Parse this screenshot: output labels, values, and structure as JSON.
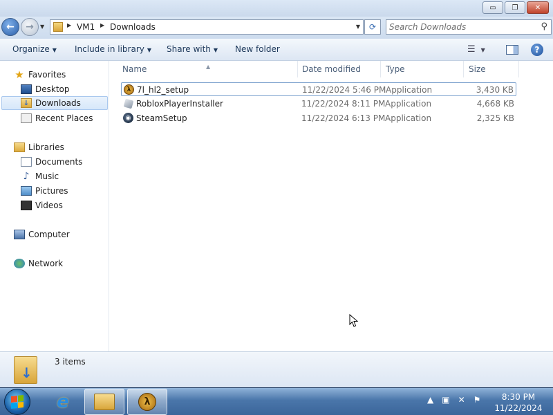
{
  "window": {
    "buttons": {
      "minimize": "▭",
      "maximize": "❐",
      "close": "✕"
    }
  },
  "address": {
    "segments": [
      "VM1",
      "Downloads"
    ],
    "search_placeholder": "Search Downloads"
  },
  "toolbar": {
    "organize": "Organize",
    "include_library": "Include in library",
    "share_with": "Share with",
    "new_folder": "New folder"
  },
  "nav": {
    "favorites": {
      "label": "Favorites",
      "items": [
        "Desktop",
        "Downloads",
        "Recent Places"
      ]
    },
    "libraries": {
      "label": "Libraries",
      "items": [
        "Documents",
        "Music",
        "Pictures",
        "Videos"
      ]
    },
    "computer": "Computer",
    "network": "Network"
  },
  "columns": {
    "name": "Name",
    "date": "Date modified",
    "type": "Type",
    "size": "Size"
  },
  "files": [
    {
      "name": "7l_hl2_setup",
      "date": "11/22/2024 5:46 PM",
      "type": "Application",
      "size": "3,430 KB",
      "icon": "hl-icon",
      "selected": true
    },
    {
      "name": "RobloxPlayerInstaller",
      "date": "11/22/2024 8:11 PM",
      "type": "Application",
      "size": "4,668 KB",
      "icon": "roblox-icon",
      "selected": false
    },
    {
      "name": "SteamSetup",
      "date": "11/22/2024 6:13 PM",
      "type": "Application",
      "size": "2,325 KB",
      "icon": "steam-icon",
      "selected": false
    }
  ],
  "status": {
    "items_count": "3 items"
  },
  "taskbar": {
    "time": "8:30 PM",
    "date": "11/22/2024"
  },
  "colors": {
    "accent": "#3b659a",
    "selection": "#d6e7fa"
  }
}
